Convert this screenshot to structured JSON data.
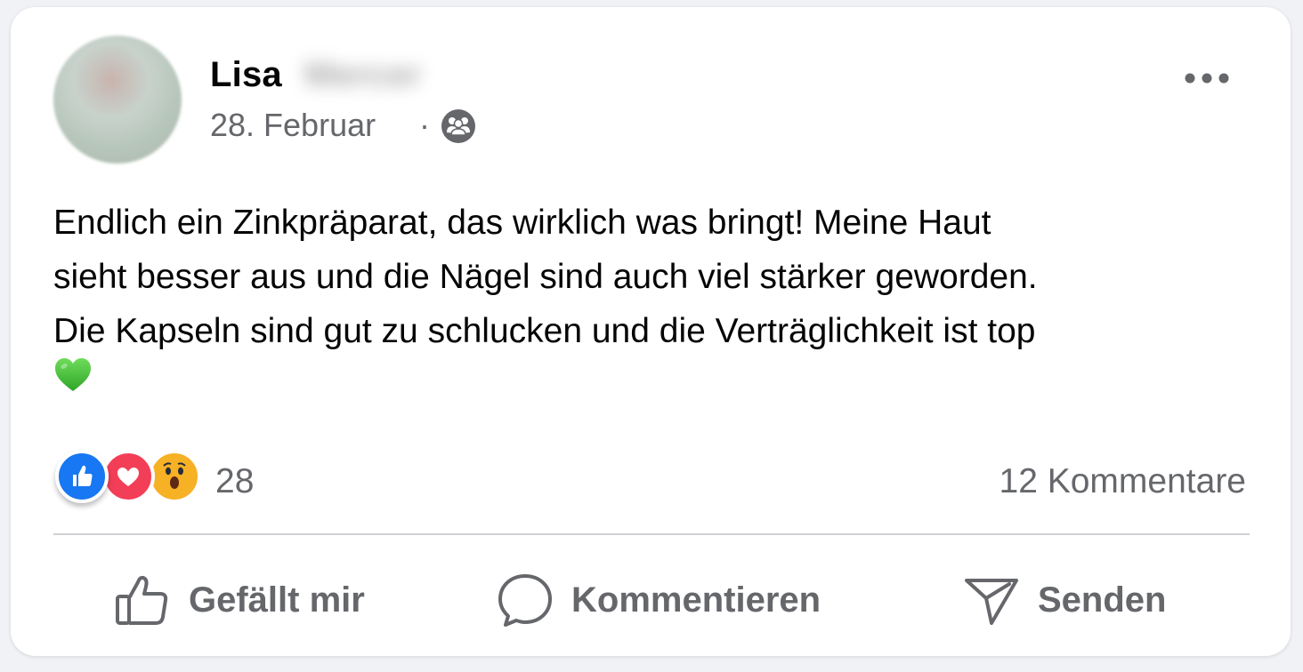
{
  "post": {
    "author": {
      "name": "Lisa",
      "avatar": "profile-photo-blurred"
    },
    "date": "28. Februar",
    "separator": "·",
    "audience_icon": "group-icon",
    "more_icon": "more-options-icon",
    "text": "Endlich ein Zinkpräparat, das wirklich was bringt! Meine Haut\nsieht besser aus und die Nägel sind auch viel stärker geworden.\nDie Kapseln sind gut zu schlucken und die Verträglichkeit ist top",
    "emoji": "green-heart-emoji"
  },
  "reactions": {
    "types": [
      "like",
      "love",
      "wow"
    ],
    "count": "28",
    "comments_label": "12 Kommentare"
  },
  "actions": {
    "like_label": "Gefällt mir",
    "comment_label": "Kommentieren",
    "send_label": "Senden"
  },
  "colors": {
    "like_blue": "#1877f2",
    "love_red": "#f33e58",
    "wow_yellow": "#f7b125",
    "secondary_text": "#65676b",
    "emoji_green": "#46c33c"
  }
}
